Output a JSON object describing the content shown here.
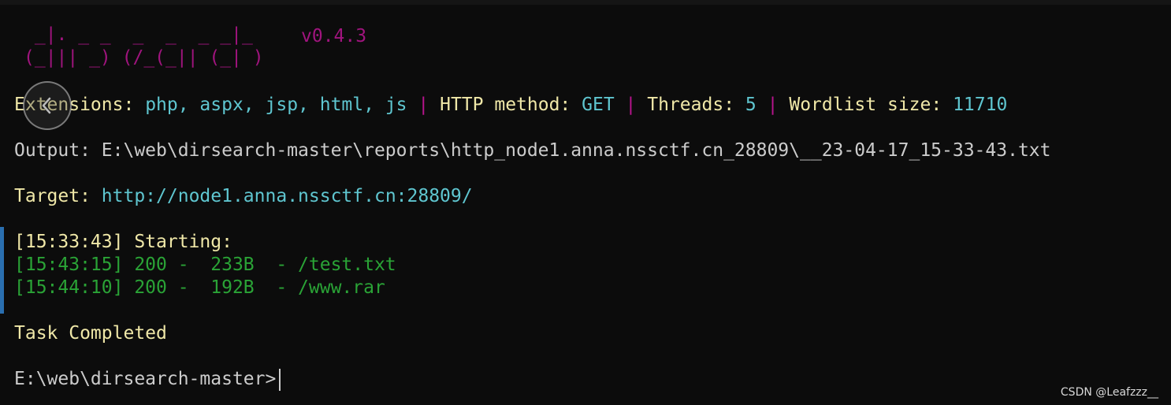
{
  "terminal": {
    "logo_line1": " _|. _ _  _  _  _ _|_",
    "logo_line2": "(_||| _) (/_(_|| (_| )",
    "version": "v0.4.3",
    "config": {
      "extensions_label": "Extensions:",
      "extensions_value": "php, aspx, jsp, html, js",
      "separator": "|",
      "method_label": "HTTP method:",
      "method_value": "GET",
      "threads_label": "Threads:",
      "threads_value": "5",
      "wordlist_label": "Wordlist size:",
      "wordlist_value": "11710"
    },
    "output_line": "Output: E:\\web\\dirsearch-master\\reports\\http_node1.anna.nssctf.cn_28809\\__23-04-17_15-33-43.txt",
    "target_label": "Target:",
    "target_value": "http://node1.anna.nssctf.cn:28809/",
    "starting_line": "[15:33:43] Starting:",
    "results": [
      "[15:43:15] 200 -  233B  - /test.txt",
      "[15:44:10] 200 -  192B  - /www.rar"
    ],
    "completed": "Task Completed",
    "prompt": "E:\\web\\dirsearch-master>"
  },
  "watermark": "CSDN @Leafzzz__",
  "icons": {
    "back": "chevron-left-icon"
  },
  "colors": {
    "background": "#0c0c0c",
    "logo": "#a0147e",
    "label_yellow": "#f0e8a8",
    "value_cyan": "#5fc6d0",
    "success_green": "#2aa336",
    "text_gray": "#cccccc"
  }
}
